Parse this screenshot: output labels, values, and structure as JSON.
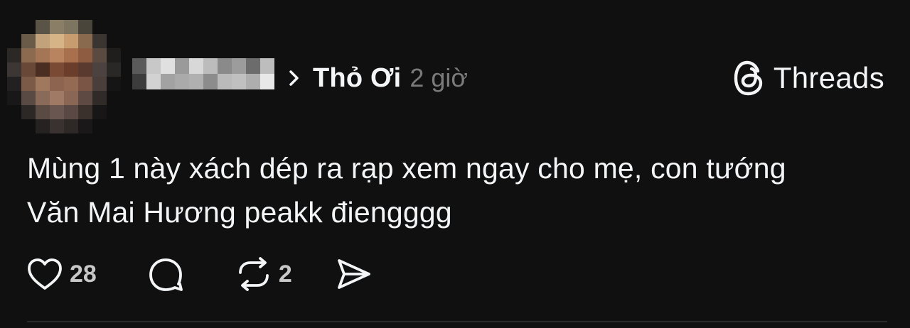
{
  "post": {
    "reply_to": "Thỏ Ơi",
    "time": "2 giờ",
    "brand": "Threads",
    "text_line1": "Mùng 1 này xách dép ra rạp xem ngay cho mẹ, con tướng",
    "text_line2": "Văn Mai Hương peakk điengggg",
    "likes": "28",
    "reposts": "2"
  },
  "icons": {
    "chevron": "chevron-right-icon",
    "brand_logo": "threads-logo-icon",
    "like": "heart-icon",
    "comment": "comment-icon",
    "repost": "repost-icon",
    "share": "send-icon"
  },
  "colors": {
    "background": "#101010",
    "text": "#f3f5f7",
    "muted": "#7a7a7a"
  }
}
